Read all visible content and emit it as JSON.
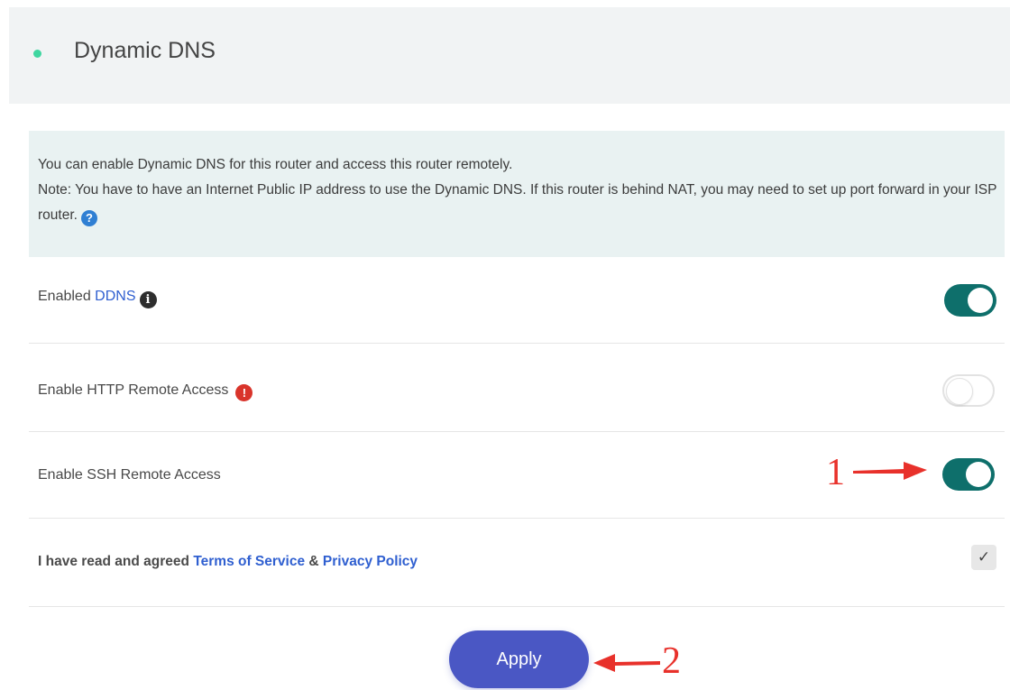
{
  "header": {
    "title": "Dynamic DNS"
  },
  "note": {
    "line1": "You can enable Dynamic DNS for this router and access this router remotely.",
    "line2": "Note: You have to have an Internet Public IP address to use the Dynamic DNS. If this router is behind NAT, you may need to set up port forward in your ISP router.",
    "help_glyph": "?"
  },
  "settings": {
    "ddns": {
      "label": "Enabled",
      "link": "DDNS",
      "enabled": true
    },
    "http": {
      "label": "Enable HTTP Remote Access",
      "enabled": false
    },
    "ssh": {
      "label": "Enable SSH Remote Access",
      "enabled": true
    }
  },
  "terms": {
    "prefix": "I have read and agreed",
    "tos": "Terms of Service",
    "amp": "&",
    "privacy": "Privacy Policy",
    "checked": true,
    "check_glyph": "✓"
  },
  "apply": {
    "label": "Apply"
  },
  "annotations": {
    "one": "1",
    "two": "2"
  },
  "colors": {
    "toggle_on": "#0e6f6b",
    "accent_dot": "#3fd6a0",
    "button": "#4a57c4",
    "link": "#2f5fd0",
    "annotation": "#e8312b"
  }
}
